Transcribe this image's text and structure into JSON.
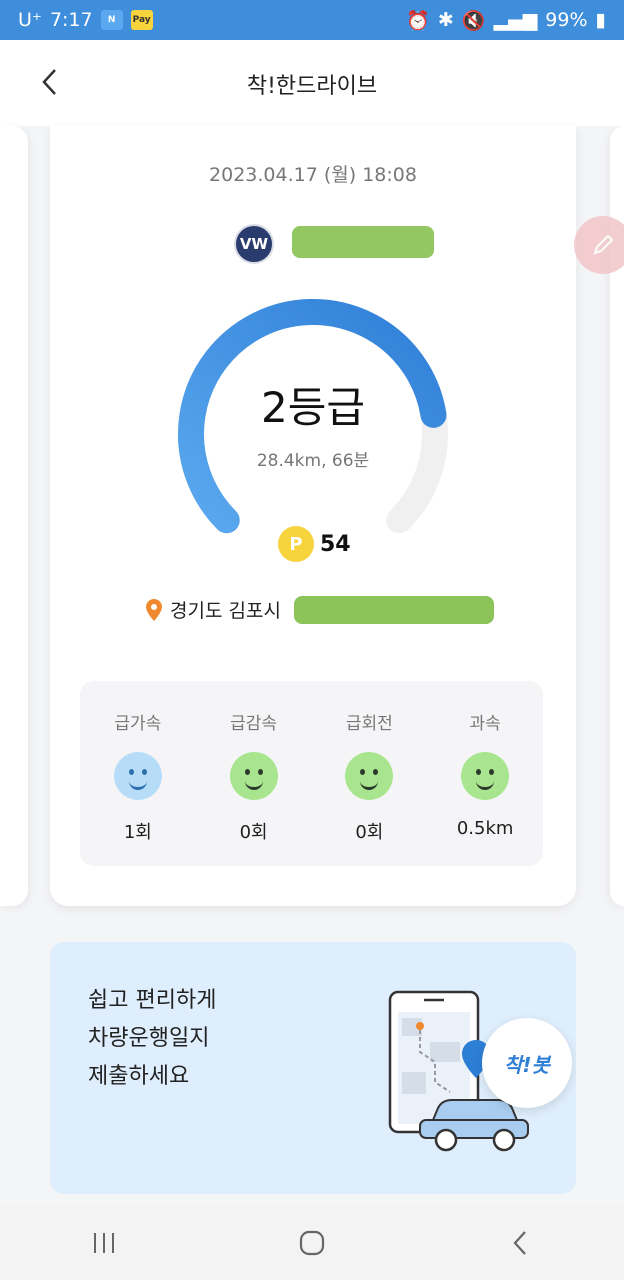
{
  "status_bar": {
    "carrier": "U⁺",
    "time": "7:17",
    "battery": "99%",
    "badge_n": "N",
    "badge_pay": "Pay"
  },
  "header": {
    "title": "착!한드라이브",
    "back_icon": "chevron-left-icon"
  },
  "trip": {
    "datetime": "2023.04.17 (월) 18:08",
    "vehicle_brand_logo": "VW",
    "grade": "2등급",
    "summary": "28.4km, 66분",
    "points_symbol": "P",
    "points": "54",
    "location": "경기도 김포시",
    "gauge_level": 0.8,
    "colors": {
      "gauge": "#3f8edb",
      "gauge_track": "#f0f0f0",
      "coin": "#f7d33c",
      "pin": "#f0892e"
    }
  },
  "stats": [
    {
      "label": "급가속",
      "value": "1회",
      "face": "blue"
    },
    {
      "label": "급감속",
      "value": "0회",
      "face": "green"
    },
    {
      "label": "급회전",
      "value": "0회",
      "face": "green"
    },
    {
      "label": "과속",
      "value": "0.5km",
      "face": "green"
    }
  ],
  "banner": {
    "line1": "쉽고 편리하게",
    "line2": "차량운행일지",
    "line3": "제출하세요",
    "badge": "착!봇"
  },
  "nav": {
    "recent_icon": "recent-apps-icon",
    "home_icon": "home-icon",
    "back_icon": "back-icon"
  }
}
